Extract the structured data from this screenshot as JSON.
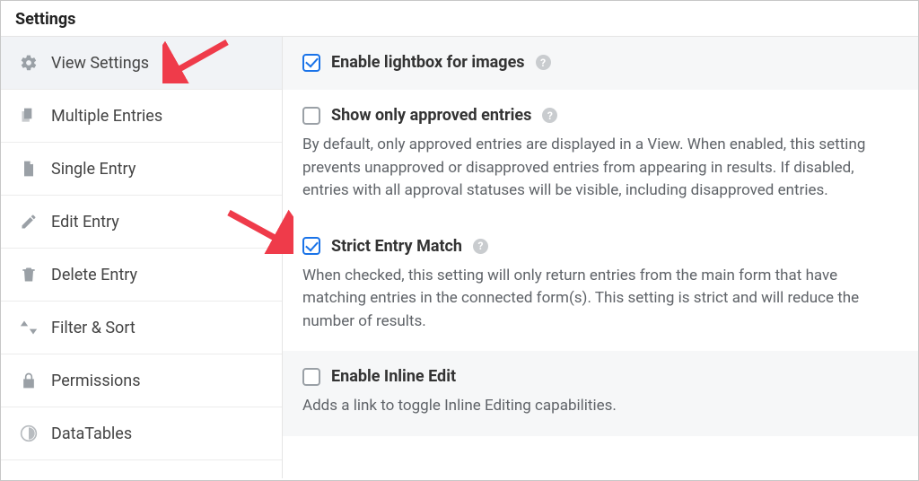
{
  "header": {
    "title": "Settings"
  },
  "sidebar": {
    "items": [
      {
        "label": "View Settings",
        "active": true
      },
      {
        "label": "Multiple Entries"
      },
      {
        "label": "Single Entry"
      },
      {
        "label": "Edit Entry"
      },
      {
        "label": "Delete Entry"
      },
      {
        "label": "Filter & Sort"
      },
      {
        "label": "Permissions"
      },
      {
        "label": "DataTables"
      }
    ]
  },
  "settings": {
    "enable_lightbox": {
      "label": "Enable lightbox for images",
      "checked": true
    },
    "approved_only": {
      "label": "Show only approved entries",
      "checked": false,
      "desc": "By default, only approved entries are displayed in a View. When enabled, this setting prevents unapproved or disapproved entries from appearing in results. If disabled, entries with all approval statuses will be visible, including disapproved entries."
    },
    "strict_match": {
      "label": "Strict Entry Match",
      "checked": true,
      "desc": "When checked, this setting will only return entries from the main form that have matching entries in the connected form(s). This setting is strict and will reduce the number of results."
    },
    "inline_edit": {
      "label": "Enable Inline Edit",
      "checked": false,
      "desc": "Adds a link to toggle Inline Editing capabilities."
    }
  }
}
